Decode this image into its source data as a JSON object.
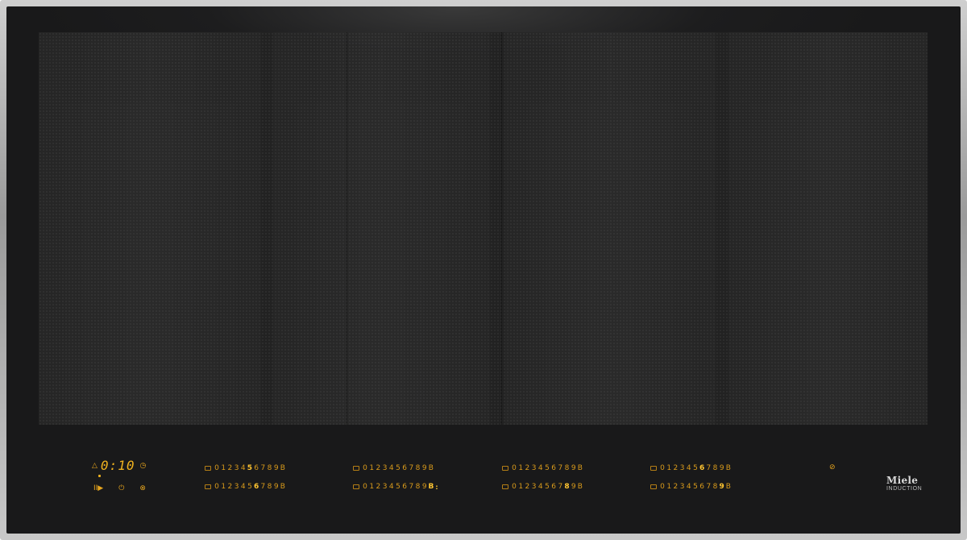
{
  "timer": {
    "up_icon": "△",
    "display": "0:10",
    "clock_icon": "◷"
  },
  "bottom_icons": {
    "stop_go": "II▶",
    "power": "⏻",
    "wipe": "⊗"
  },
  "zones": [
    {
      "levels": [
        "0",
        "1",
        "2",
        "3",
        "4",
        "5",
        "6",
        "7",
        "8",
        "9",
        "B"
      ],
      "active_index": 5
    },
    {
      "levels": [
        "0",
        "1",
        "2",
        "3",
        "4",
        "5",
        "6",
        "7",
        "8",
        "9",
        "B"
      ],
      "active_index": 6
    },
    {
      "levels": [
        "0",
        "1",
        "2",
        "3",
        "4",
        "5",
        "6",
        "7",
        "8",
        "9",
        "B"
      ],
      "active_index": null
    },
    {
      "levels": [
        "0",
        "1",
        "2",
        "3",
        "4",
        "5",
        "6",
        "7",
        "8",
        "9",
        "B"
      ],
      "active_index": 10,
      "suffix": ":"
    },
    {
      "levels": [
        "0",
        "1",
        "2",
        "3",
        "4",
        "5",
        "6",
        "7",
        "8",
        "9",
        "B"
      ],
      "active_index": null
    },
    {
      "levels": [
        "0",
        "1",
        "2",
        "3",
        "4",
        "5",
        "6",
        "7",
        "8",
        "9",
        "B"
      ],
      "active_index": 8
    },
    {
      "levels": [
        "0",
        "1",
        "2",
        "3",
        "4",
        "5",
        "6",
        "7",
        "8",
        "9",
        "B"
      ],
      "active_index": 6
    },
    {
      "levels": [
        "0",
        "1",
        "2",
        "3",
        "4",
        "5",
        "6",
        "7",
        "8",
        "9",
        "B"
      ],
      "active_index": 9
    }
  ],
  "lock_icon": "⊘",
  "brand": {
    "name": "Miele",
    "sub": "INDUCTION"
  },
  "colors": {
    "display_amber": "#e7a51d",
    "active_level": "#ffc531",
    "glass": "#1d1d1e",
    "frame": "#b0b0b0"
  }
}
